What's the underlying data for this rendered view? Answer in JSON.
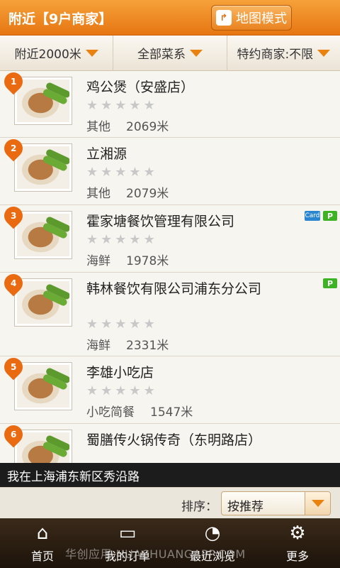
{
  "header": {
    "title": "附近【9户商家】",
    "map_mode_label": "地图模式"
  },
  "filters": [
    {
      "label": "附近2000米"
    },
    {
      "label": "全部菜系"
    },
    {
      "label": "特约商家:不限"
    }
  ],
  "restaurants": [
    {
      "index": "1",
      "name": "鸡公煲（安盛店）",
      "category": "其他",
      "distance": "2069米",
      "stars": 5,
      "badges": []
    },
    {
      "index": "2",
      "name": "立湘源",
      "category": "其他",
      "distance": "2079米",
      "stars": 5,
      "badges": []
    },
    {
      "index": "3",
      "name": "霍家塘餐饮管理有限公司",
      "category": "海鲜",
      "distance": "1978米",
      "stars": 5,
      "badges": [
        "Card",
        "P"
      ]
    },
    {
      "index": "4",
      "name": "韩林餐饮有限公司浦东分公司",
      "category": "海鲜",
      "distance": "2331米",
      "stars": 5,
      "badges": [
        "P"
      ]
    },
    {
      "index": "5",
      "name": "李雄小吃店",
      "category": "小吃简餐",
      "distance": "1547米",
      "stars": 5,
      "badges": []
    },
    {
      "index": "6",
      "name": "蜀膳传火锅传奇（东明路店）",
      "category": "",
      "distance": "",
      "stars": 5,
      "badges": []
    }
  ],
  "location_text": "我在上海浦东新区秀沿路",
  "sort": {
    "label": "排序：",
    "value": "按推荐"
  },
  "nav": [
    {
      "label": "首页",
      "icon": "home-icon"
    },
    {
      "label": "我的订单",
      "icon": "folder-icon"
    },
    {
      "label": "最近浏览",
      "icon": "history-icon"
    },
    {
      "label": "更多",
      "icon": "gears-icon"
    }
  ],
  "watermark": "华创应用 HUACHUANGAPP.COM",
  "colors": {
    "accent": "#e67612",
    "star_empty": "#c8c8c8",
    "card_badge": "#2b86d1",
    "p_badge": "#3db224"
  }
}
